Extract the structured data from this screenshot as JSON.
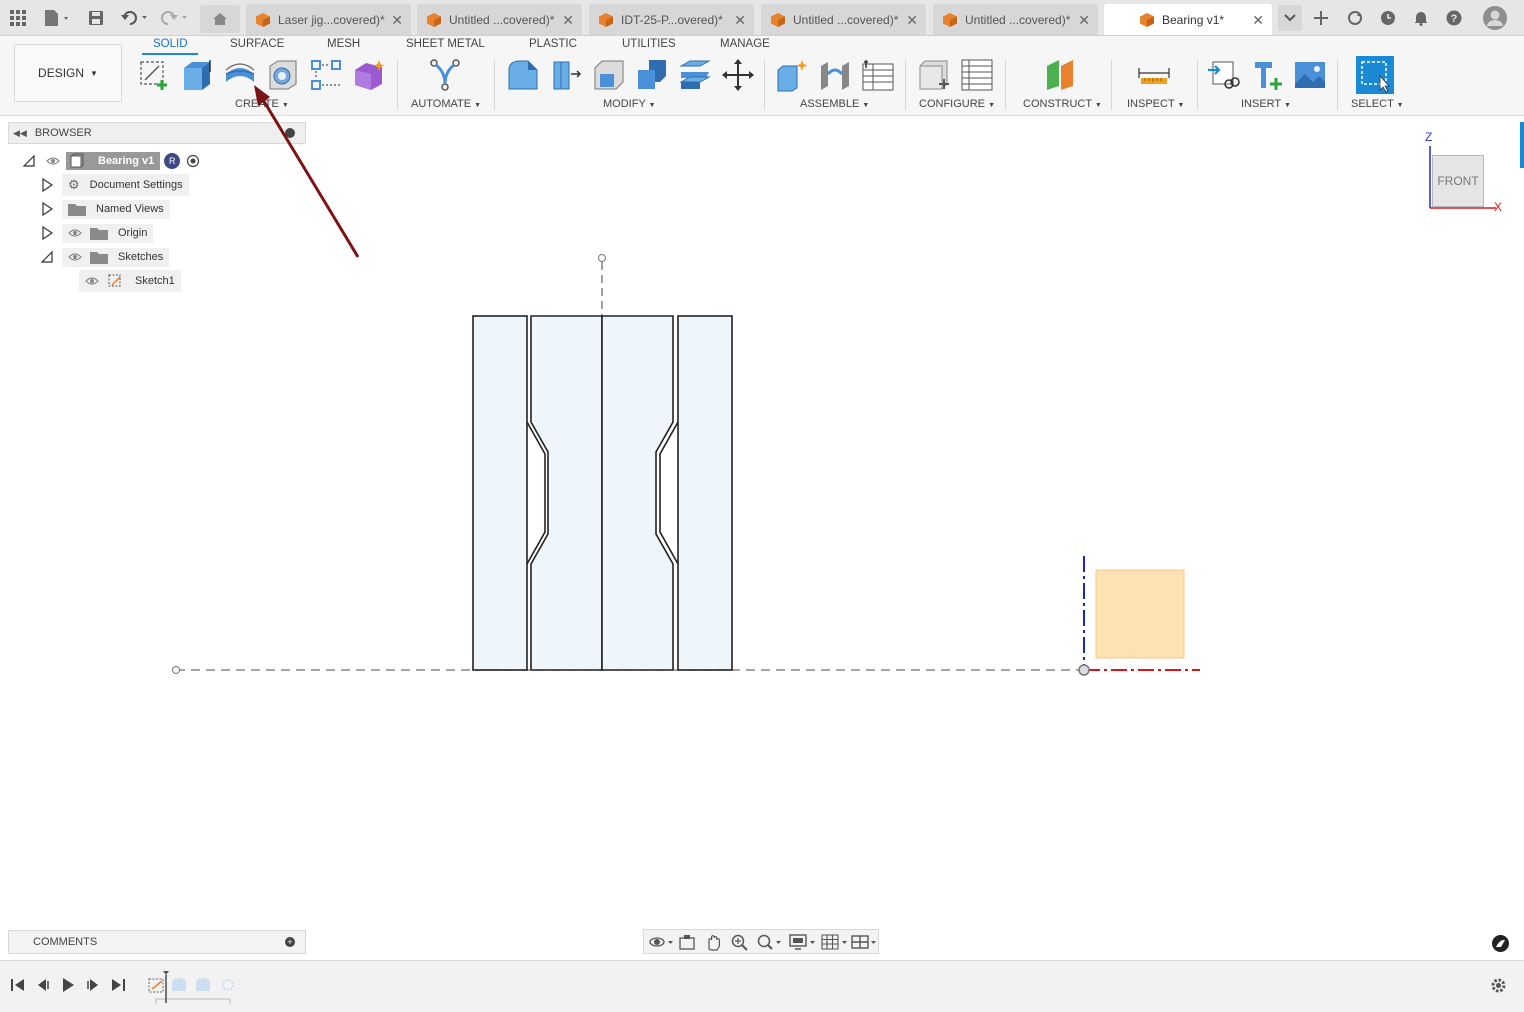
{
  "tabs": [
    {
      "label": "Laser jig...covered)*",
      "active": false
    },
    {
      "label": "Untitled ...covered)*",
      "active": false
    },
    {
      "label": "IDT-25-P...overed)*",
      "active": false
    },
    {
      "label": "Untitled ...covered)*",
      "active": false
    },
    {
      "label": "Untitled ...covered)*",
      "active": false
    },
    {
      "label": "Bearing v1*",
      "active": true
    }
  ],
  "workspace": {
    "label": "DESIGN"
  },
  "toolbar_tabs": [
    "SOLID",
    "SURFACE",
    "MESH",
    "SHEET METAL",
    "PLASTIC",
    "UTILITIES",
    "MANAGE"
  ],
  "groups": {
    "create": "CREATE",
    "automate": "AUTOMATE",
    "modify": "MODIFY",
    "assemble": "ASSEMBLE",
    "configure": "CONFIGURE",
    "construct": "CONSTRUCT",
    "inspect": "INSPECT",
    "insert": "INSERT",
    "select": "SELECT"
  },
  "browser": {
    "title": "BROWSER",
    "root": "Bearing v1",
    "root_badge": "R",
    "items": [
      "Document Settings",
      "Named Views",
      "Origin",
      "Sketches",
      "Sketch1"
    ]
  },
  "viewcube": {
    "face": "FRONT",
    "axis_z": "Z",
    "axis_x": "X"
  },
  "comments": {
    "label": "COMMENTS"
  },
  "colors": {
    "accent": "#1a8ad4",
    "annotation_arrow": "#7a1416",
    "profile_fill": "#eef6fc",
    "selected_region": "#fde3b4"
  }
}
